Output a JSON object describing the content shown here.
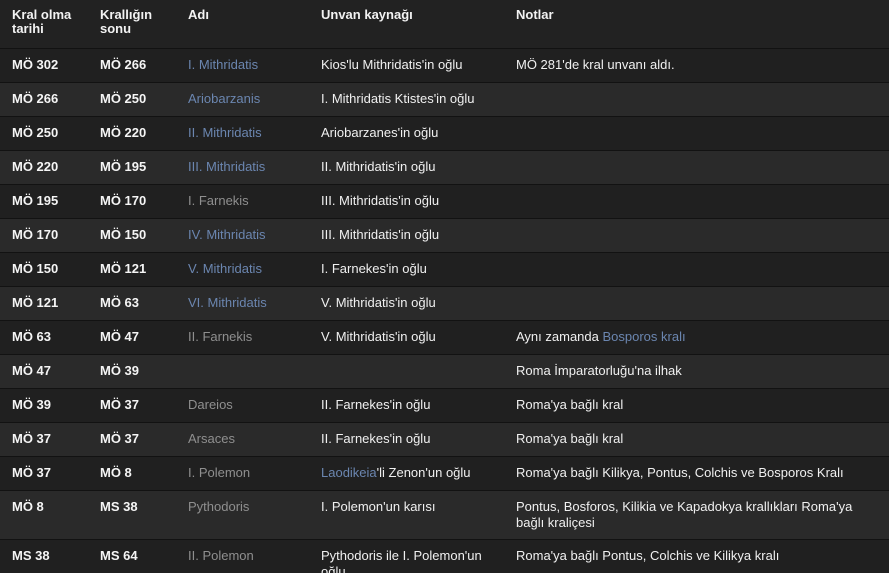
{
  "headers": {
    "start": "Kral olma tarihi",
    "end": "Krallığın sonu",
    "name": "Adı",
    "source": "Unvan kaynağı",
    "notes": "Notlar"
  },
  "rows": [
    {
      "start": "MÖ 302",
      "end": "MÖ 266",
      "name": "I. Mithridatis",
      "name_style": "link",
      "source": "Kios'lu Mithridatis'in oğlu",
      "notes": "MÖ 281'de kral unvanı aldı."
    },
    {
      "start": "MÖ 266",
      "end": "MÖ 250",
      "name": "Ariobarzanis",
      "name_style": "link",
      "source": "I. Mithridatis Ktistes'in oğlu",
      "notes": ""
    },
    {
      "start": "MÖ 250",
      "end": "MÖ 220",
      "name": "II. Mithridatis",
      "name_style": "link",
      "source": "Ariobarzanes'in oğlu",
      "notes": ""
    },
    {
      "start": "MÖ 220",
      "end": "MÖ 195",
      "name": "III. Mithridatis",
      "name_style": "link",
      "source": "II. Mithridatis'in oğlu",
      "notes": ""
    },
    {
      "start": "MÖ 195",
      "end": "MÖ 170",
      "name": "I. Farnekis",
      "name_style": "muted",
      "source": "III. Mithridatis'in oğlu",
      "notes": ""
    },
    {
      "start": "MÖ 170",
      "end": "MÖ 150",
      "name": "IV. Mithridatis",
      "name_style": "link",
      "source": "III. Mithridatis'in oğlu",
      "notes": ""
    },
    {
      "start": "MÖ 150",
      "end": "MÖ 121",
      "name": "V. Mithridatis",
      "name_style": "link",
      "source": "I. Farnekes'in oğlu",
      "notes": ""
    },
    {
      "start": "MÖ 121",
      "end": "MÖ 63",
      "name": "VI. Mithridatis",
      "name_style": "link",
      "source": "V. Mithridatis'in oğlu",
      "notes": ""
    },
    {
      "start": "MÖ 63",
      "end": "MÖ 47",
      "name": "II. Farnekis",
      "name_style": "muted",
      "source": "V. Mithridatis'in oğlu",
      "notes": "Aynı zamanda ",
      "notes_link": "Bosporos kralı"
    },
    {
      "start": "MÖ 47",
      "end": "MÖ 39",
      "name": "",
      "name_style": "muted",
      "source": "",
      "notes": "Roma İmparatorluğu'na ilhak"
    },
    {
      "start": "MÖ 39",
      "end": "MÖ 37",
      "name": "Dareios",
      "name_style": "muted",
      "source": "II. Farnekes'in oğlu",
      "notes": "Roma'ya bağlı kral"
    },
    {
      "start": "MÖ 37",
      "end": "MÖ 37",
      "name": "Arsaces",
      "name_style": "muted",
      "source": "II. Farnekes'in oğlu",
      "notes": "Roma'ya bağlı kral"
    },
    {
      "start": "MÖ 37",
      "end": "MÖ 8",
      "name": "I. Polemon",
      "name_style": "muted",
      "source_link": "Laodikeia",
      "source": "'li Zenon'un oğlu",
      "notes": "Roma'ya bağlı Kilikya, Pontus, Colchis ve Bosporos Kralı"
    },
    {
      "start": "MÖ 8",
      "end": "MS 38",
      "name": "Pythodoris",
      "name_style": "muted",
      "source": "I. Polemon'un karısı",
      "notes": "Pontus, Bosforos, Kilikia ve Kapadokya krallıkları Roma'ya bağlı kraliçesi"
    },
    {
      "start": "MS 38",
      "end": "MS 64",
      "name": "II. Polemon",
      "name_style": "muted",
      "source": "Pythodoris ile I. Polemon'un oğlu",
      "notes": "Roma'ya bağlı Pontus, Colchis ve Kilikya kralı"
    }
  ],
  "colors": {
    "background": "#202020",
    "row_alt": "#2a2a2a",
    "link": "#6b86b0",
    "muted": "#8f8f8f",
    "text": "#f0f0f0"
  }
}
